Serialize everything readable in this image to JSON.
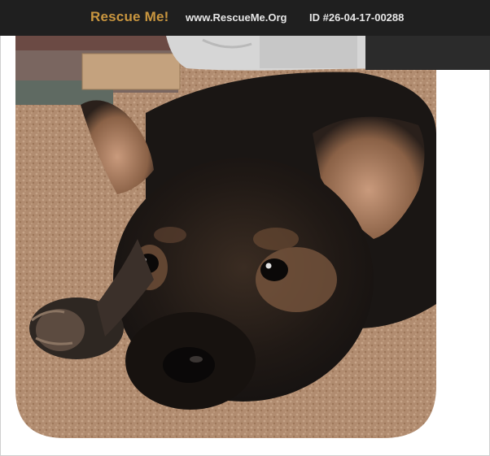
{
  "header": {
    "logo_text": "Rescue Me!",
    "site_url": "www.RescueMe.Org",
    "listing_id": "ID #26-04-17-00288"
  },
  "photo": {
    "subject": "german-shepherd-puppy",
    "colors": {
      "header_bg": "#1f1f1f",
      "logo": "#c9963f",
      "carpet": "#b08a6e",
      "fur_dark": "#1e1a18",
      "fur_tan": "#a97d55"
    }
  }
}
